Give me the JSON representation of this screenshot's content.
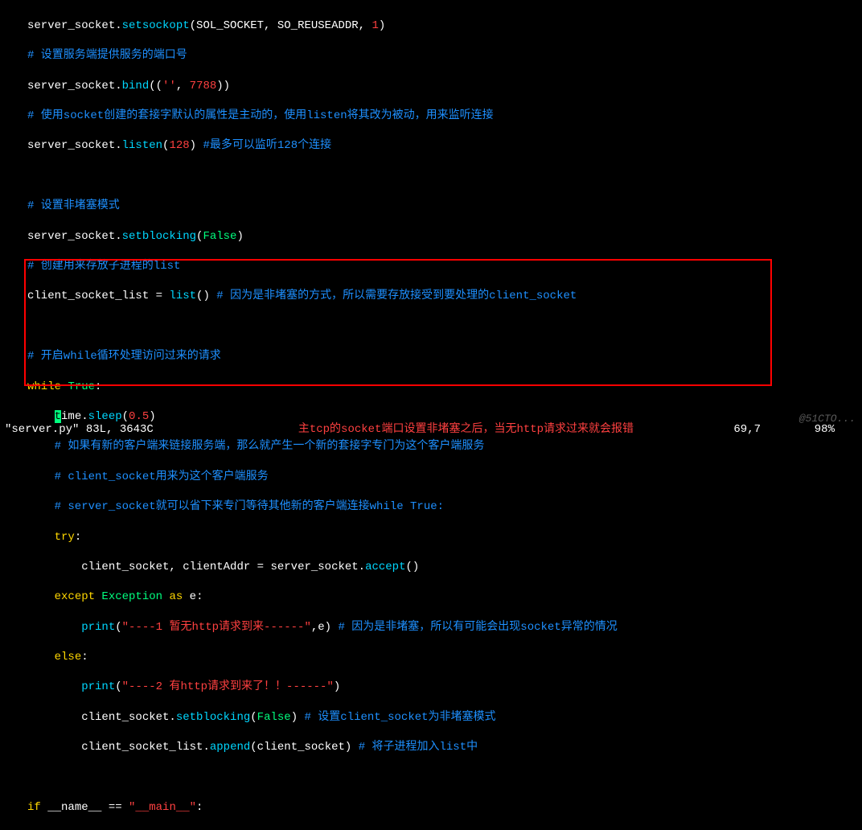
{
  "lines": {
    "l1": {
      "a": "server_socket.",
      "b": "setsockopt",
      "c": "(SOL_SOCKET, SO_REUSEADDR, ",
      "d": "1",
      "e": ")"
    },
    "l2": "# 设置服务端提供服务的端口号",
    "l3": {
      "a": "server_socket.",
      "b": "bind",
      "c": "((",
      "d": "''",
      "e": ", ",
      "f": "7788",
      "g": "))"
    },
    "l4": "# 使用socket创建的套接字默认的属性是主动的，使用listen将其改为被动，用来监听连接",
    "l5": {
      "a": "server_socket.",
      "b": "listen",
      "c": "(",
      "d": "128",
      "e": ") ",
      "f": "#最多可以监听128个连接"
    },
    "l6": "",
    "l7": "# 设置非堵塞模式",
    "l8": {
      "a": "server_socket.",
      "b": "setblocking",
      "c": "(",
      "d": "False",
      "e": ")"
    },
    "l9": "# 创建用来存放子进程的list",
    "l10": {
      "a": "client_socket_list = ",
      "b": "list",
      "c": "() ",
      "d": "# 因为是非堵塞的方式，所以需要存放接受到要处理的client_socket"
    },
    "l11": "",
    "l12": "# 开启while循环处理访问过来的请求",
    "l13": {
      "a": "while ",
      "b": "True",
      "c": ":"
    },
    "l14pre": "    ",
    "l14a": "t",
    "l14b": "ime.",
    "l14c": "sleep",
    "l14d": "(",
    "l14e": "0.5",
    "l14f": ")",
    "l15": "    # 如果有新的客户端来链接服务端，那么就产生一个新的套接字专门为这个客户端服务",
    "l16": "    # client_socket用来为这个客户端服务",
    "l17": "    # server_socket就可以省下来专门等待其他新的客户端连接while True:",
    "l18": {
      "pre": "    ",
      "a": "try",
      "b": ":"
    },
    "l19": {
      "pre": "        ",
      "a": "client_socket, clientAddr = server_socket.",
      "b": "accept",
      "c": "()"
    },
    "l20": {
      "pre": "    ",
      "a": "except ",
      "b": "Exception",
      "c": " as",
      "d": " e:"
    },
    "l21": {
      "pre": "        ",
      "a": "print",
      "b": "(",
      "c": "\"----1 暂无http请求到来------\"",
      "d": ",e) ",
      "e": "# 因为是非堵塞，所以有可能会出现socket异常的情况"
    },
    "l22": {
      "pre": "    ",
      "a": "else",
      "b": ":"
    },
    "l23": {
      "pre": "        ",
      "a": "print",
      "b": "(",
      "c": "\"----2 有http请求到来了！！------\"",
      "d": ")"
    },
    "l24": {
      "pre": "        ",
      "a": "client_socket.",
      "b": "setblocking",
      "c": "(",
      "d": "False",
      "e": ") ",
      "f": "# 设置client_socket为非堵塞模式"
    },
    "l25": {
      "pre": "        ",
      "a": "client_socket_list.",
      "b": "append",
      "c": "(client_socket) ",
      "d": "# 将子进程加入list中"
    },
    "l26": "",
    "l27": {
      "a": "if",
      "b": " __name__ == ",
      "c": "\"__main__\"",
      "d": ":"
    }
  },
  "status": {
    "file": "\"server.py\" 83L, 3643C",
    "note": "主tcp的socket端口设置非堵塞之后，当无http请求过来就会报错",
    "pos": "69,7",
    "pct": "98%"
  },
  "watermark": "@51CTO..."
}
